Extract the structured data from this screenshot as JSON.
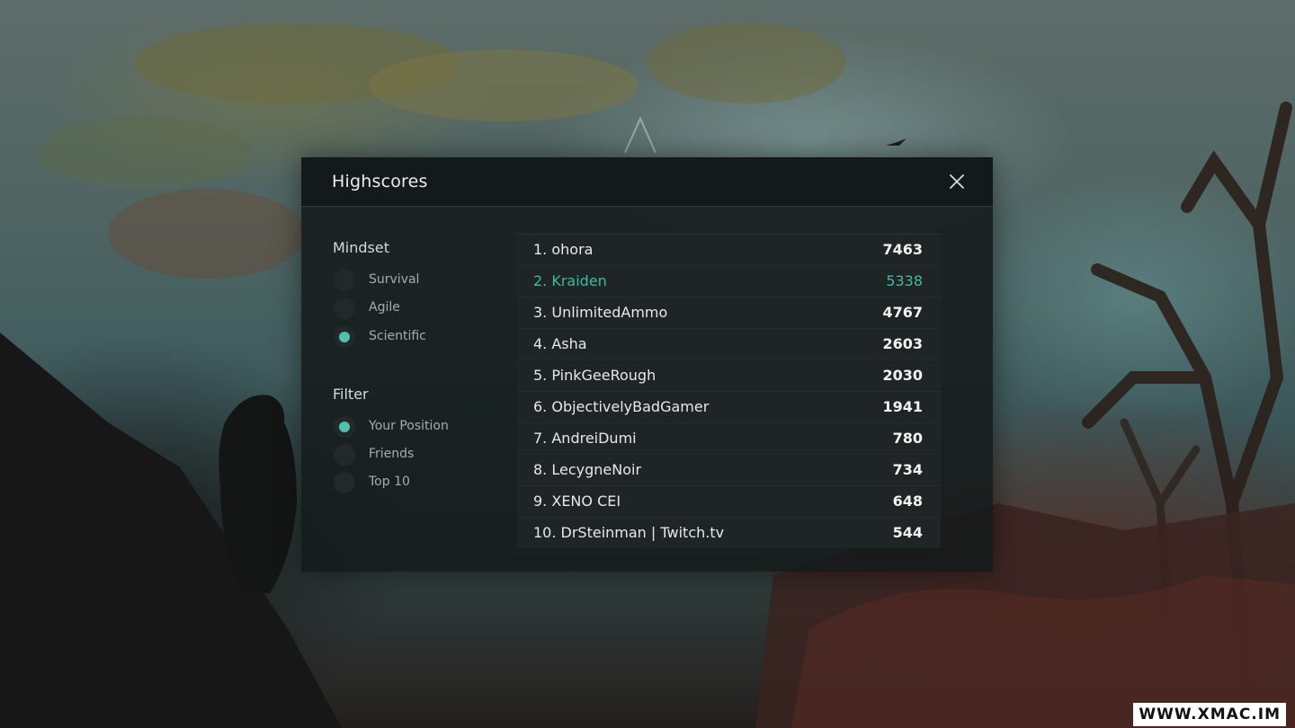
{
  "dialog": {
    "title": "Highscores",
    "close_icon": "close-icon"
  },
  "mindset": {
    "title": "Mindset",
    "options": [
      {
        "label": "Survival",
        "selected": false
      },
      {
        "label": "Agile",
        "selected": false
      },
      {
        "label": "Scientific",
        "selected": true
      }
    ]
  },
  "filter": {
    "title": "Filter",
    "options": [
      {
        "label": "Your Position",
        "selected": true
      },
      {
        "label": "Friends",
        "selected": false
      },
      {
        "label": "Top 10",
        "selected": false
      }
    ]
  },
  "highscores": [
    {
      "name": "1. ohora",
      "score": "7463",
      "highlighted": false
    },
    {
      "name": "2. Kraiden",
      "score": "5338",
      "highlighted": true
    },
    {
      "name": "3. UnlimitedAmmo",
      "score": "4767",
      "highlighted": false
    },
    {
      "name": "4. Asha",
      "score": "2603",
      "highlighted": false
    },
    {
      "name": "5. PinkGeeRough",
      "score": "2030",
      "highlighted": false
    },
    {
      "name": "6. ObjectivelyBadGamer",
      "score": "1941",
      "highlighted": false
    },
    {
      "name": "7. AndreiDumi",
      "score": "780",
      "highlighted": false
    },
    {
      "name": "8. LecygneNoir",
      "score": "734",
      "highlighted": false
    },
    {
      "name": "9. XENO CEI",
      "score": "648",
      "highlighted": false
    },
    {
      "name": "10. DrSteinman | Twitch.tv",
      "score": "544",
      "highlighted": false
    }
  ],
  "colors": {
    "accent": "#3fb9a6",
    "radio_selected": "#4fc1ad"
  },
  "watermark": "WWW.XMAC.IM"
}
